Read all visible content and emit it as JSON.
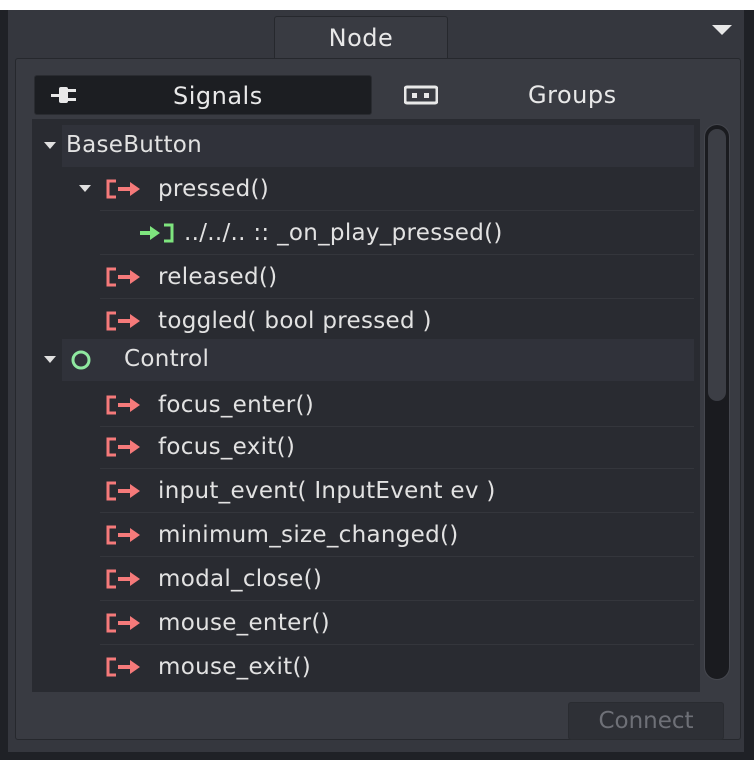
{
  "header": {
    "tab_label": "Node",
    "menu_icon": "caret-down-icon"
  },
  "subtabs": [
    {
      "label": "Signals",
      "icon": "plug-icon",
      "active": true
    },
    {
      "label": "Groups",
      "icon": "groups-icon",
      "active": false
    }
  ],
  "tree": {
    "basebutton": {
      "label": "BaseButton",
      "pressed": "pressed()",
      "pressed_connection": "../../.. :: _on_play_pressed()",
      "released": "released()",
      "toggled": "toggled( bool pressed )"
    },
    "control": {
      "label": "Control",
      "signals": [
        "focus_enter()",
        "focus_exit()",
        "input_event( InputEvent ev )",
        "minimum_size_changed()",
        "modal_close()",
        "mouse_enter()",
        "mouse_exit()"
      ]
    }
  },
  "footer": {
    "connect_label": "Connect"
  },
  "colors": {
    "signal_icon": "#f57a7a",
    "connection_icon": "#7ee57e",
    "control_icon": "#8fe8a0"
  }
}
